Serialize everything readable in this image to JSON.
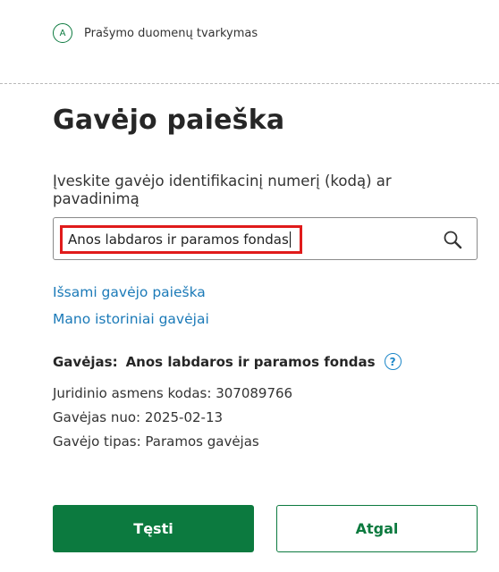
{
  "step": {
    "letter": "A",
    "label": "Prašymo duomenų tvarkymas"
  },
  "title": "Gavėjo paieška",
  "search": {
    "label": "Įveskite gavėjo identifikacinį numerį (kodą) ar pavadinimą",
    "value": "Anos labdaros ir paramos fondas",
    "icon": "search-icon"
  },
  "links": {
    "detailed": "Išsami gavėjo paieška",
    "history": "Mano istoriniai gavėjai"
  },
  "recipient": {
    "label": "Gavėjas:",
    "name": "Anos labdaros ir paramos fondas",
    "help": "?",
    "code": "Juridinio asmens kodas: 307089766",
    "since": "Gavėjas nuo: 2025-02-13",
    "type": "Gavėjo tipas: Paramos gavėjas"
  },
  "buttons": {
    "continue": "Tęsti",
    "back": "Atgal"
  },
  "colors": {
    "primary": "#0c7a3f",
    "link": "#1b7ab8",
    "highlight": "#e01b1b"
  }
}
